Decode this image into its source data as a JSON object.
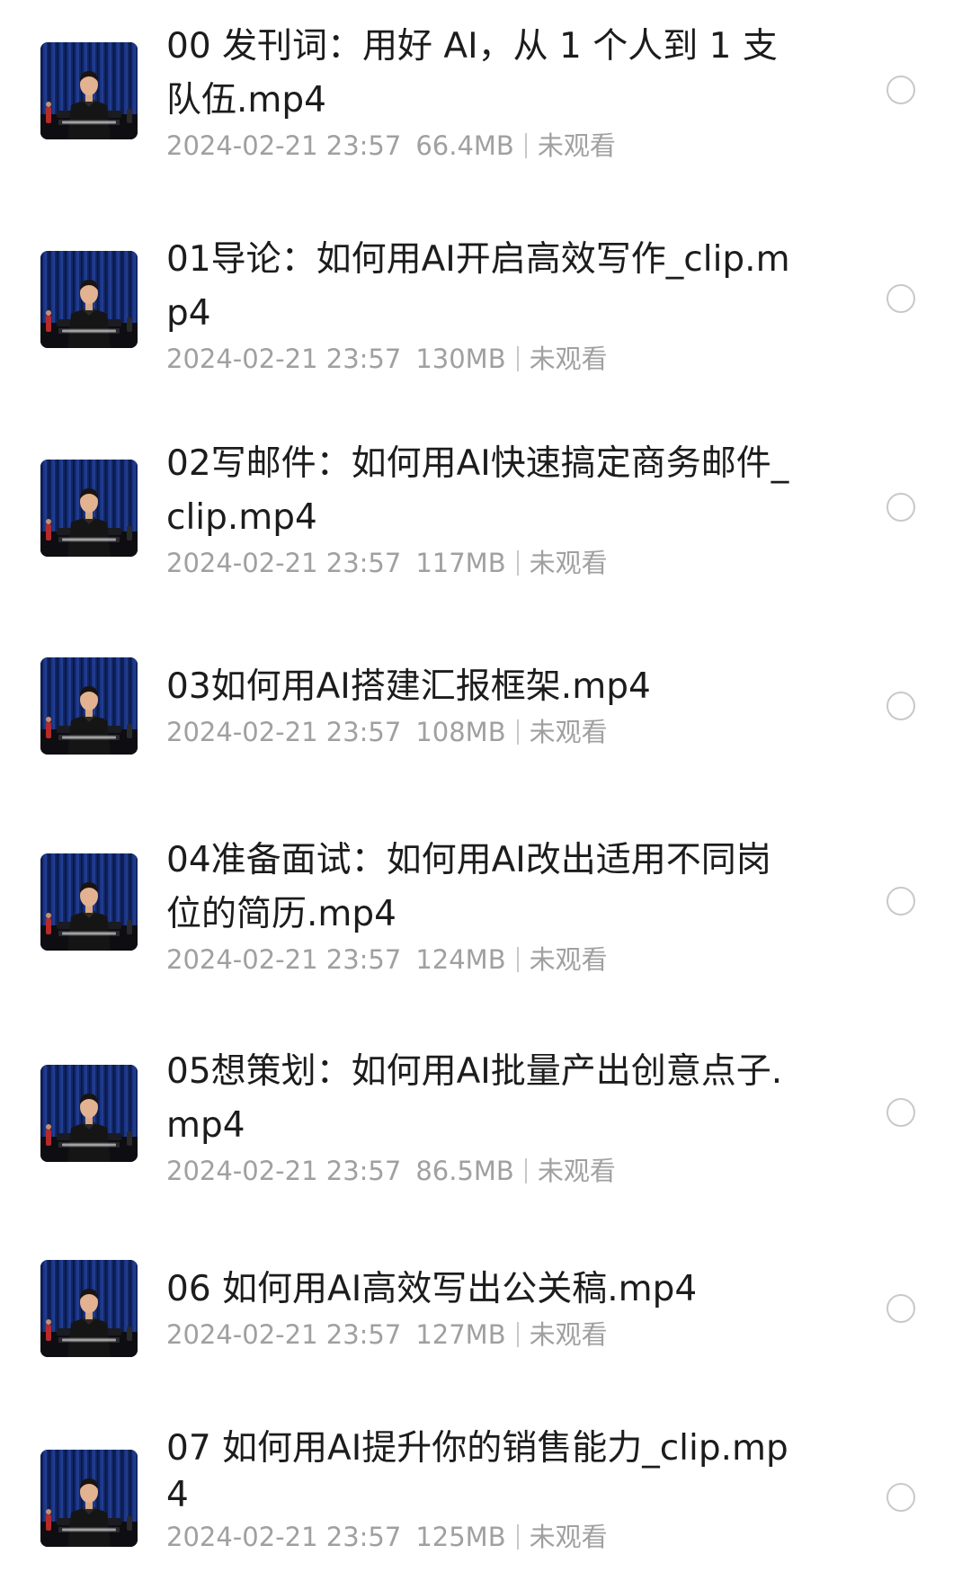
{
  "files": [
    {
      "title": "00 发刊词：用好 AI，从 1 个人到 1 支队伍.mp4",
      "date": "2024-02-21 23:57",
      "size": "66.4MB",
      "status": "未观看"
    },
    {
      "title": "01导论：如何用AI开启高效写作_clip.mp4",
      "date": "2024-02-21 23:57",
      "size": "130MB",
      "status": "未观看"
    },
    {
      "title": "02写邮件：如何用AI快速搞定商务邮件_clip.mp4",
      "date": "2024-02-21 23:57",
      "size": "117MB",
      "status": "未观看"
    },
    {
      "title": "03如何用AI搭建汇报框架.mp4",
      "date": "2024-02-21 23:57",
      "size": "108MB",
      "status": "未观看"
    },
    {
      "title": "04准备面试：如何用AI改出适用不同岗位的简历.mp4",
      "date": "2024-02-21 23:57",
      "size": "124MB",
      "status": "未观看"
    },
    {
      "title": "05想策划：如何用AI批量产出创意点子.mp4",
      "date": "2024-02-21 23:57",
      "size": "86.5MB",
      "status": "未观看"
    },
    {
      "title": "06 如何用AI高效写出公关稿.mp4",
      "date": "2024-02-21 23:57",
      "size": "127MB",
      "status": "未观看"
    },
    {
      "title": "07 如何用AI提升你的销售能力_clip.mp4",
      "date": "2024-02-21 23:57",
      "size": "125MB",
      "status": "未观看"
    }
  ]
}
